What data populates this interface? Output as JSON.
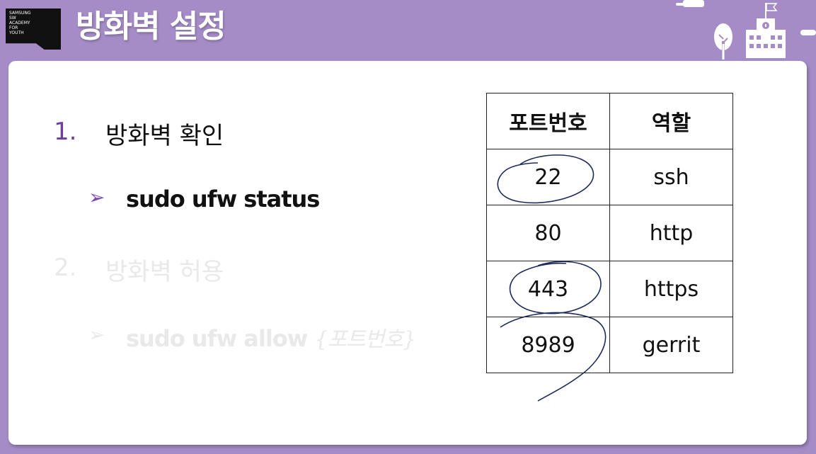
{
  "logo": {
    "text": "SAMSUNG\nSW\nACADEMY\nFOR\nYOUTH"
  },
  "slide": {
    "title": "방화벽 설정"
  },
  "steps": [
    {
      "number": "1.",
      "heading": "방화벽 확인",
      "command": "sudo ufw status",
      "state": "active"
    },
    {
      "number": "2.",
      "heading": "방화벽 허용",
      "command": "sudo ufw allow",
      "command_arg": "{포트번호}",
      "state": "faded"
    }
  ],
  "ports_table": {
    "headers": [
      "포트번호",
      "역할"
    ],
    "rows": [
      [
        "22",
        "ssh"
      ],
      [
        "80",
        "http"
      ],
      [
        "443",
        "https"
      ],
      [
        "8989",
        "gerrit"
      ]
    ]
  },
  "colors": {
    "header_bg": "#a58cc6",
    "accent_purple": "#6b3f9e",
    "faded_text": "#e9e9e9",
    "pen_ink": "#1f2a5c"
  },
  "icons": {
    "bullet": "arrow-bullet-icon",
    "decoration": [
      "tree-icon",
      "school-building-icon",
      "flag-icon"
    ]
  }
}
